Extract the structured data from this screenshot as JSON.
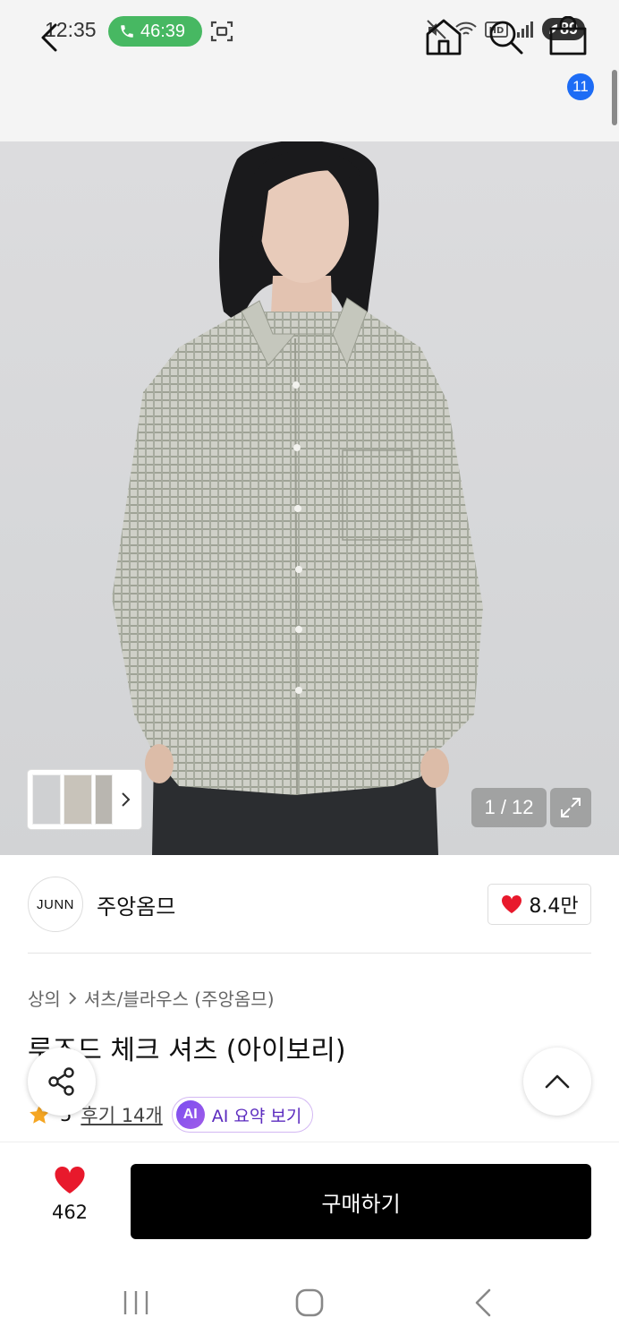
{
  "status_bar": {
    "time": "12:35",
    "call_timer": "46:39",
    "battery": "89"
  },
  "header": {
    "cart_count": "11"
  },
  "gallery": {
    "counter": "1 / 12"
  },
  "brand": {
    "logo_text": "JUNN",
    "name": "주앙옴므",
    "likes": "8.4만"
  },
  "breadcrumb": [
    "상의",
    "셔츠/블라우스 (주앙옴므)"
  ],
  "product": {
    "title": "루즈드 체크 셔츠 (아이보리)",
    "rating": "5",
    "reviews": "후기 14개",
    "ai_badge": "AI",
    "ai_summary": "AI 요약 보기"
  },
  "purchase": {
    "wish_count": "462",
    "buy_label": "구매하기"
  },
  "colors": {
    "accent_green": "#47b862",
    "badge_blue": "#1d6cf5",
    "heart_red": "#e8192c",
    "buy_black": "#000000"
  }
}
